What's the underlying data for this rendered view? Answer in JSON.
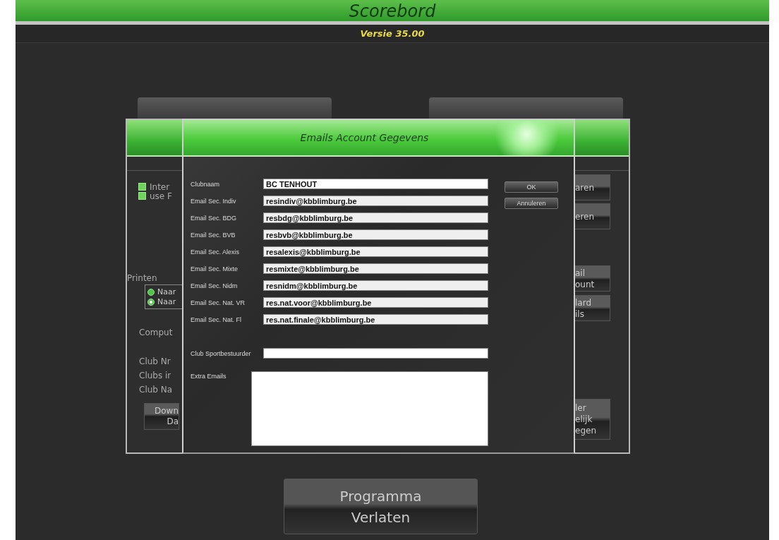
{
  "app": {
    "title": "Scorebord",
    "version": "Versie 35.00"
  },
  "background_window": {
    "checkboxes": [
      {
        "label": "Inter",
        "checked": true
      },
      {
        "label": "use F",
        "checked": true
      }
    ],
    "print_group": {
      "label": "Printen",
      "options": [
        {
          "label": "Naar",
          "selected": false
        },
        {
          "label": "Naar",
          "selected": true
        }
      ]
    },
    "labels": [
      "Comput",
      "Club Nr",
      "Clubs ir",
      "Club Na"
    ],
    "left_button": {
      "lines": [
        "Down",
        "Da"
      ]
    },
    "right_buttons": [
      {
        "lines": [
          "aren"
        ]
      },
      {
        "lines": [
          "eren"
        ]
      },
      {
        "lines": [
          "ail",
          "ount"
        ]
      },
      {
        "lines": [
          "lard",
          "ils"
        ]
      },
      {
        "lines": [
          "ler",
          "elijk",
          "egen"
        ]
      }
    ]
  },
  "dialog": {
    "title": "Emails Account Gegevens",
    "fields": [
      {
        "label": "Clubnaam",
        "value": "BC TENHOUT",
        "readonly": false
      },
      {
        "label": "Email Sec. Indiv",
        "value": "resindiv@kbblimburg.be",
        "readonly": true
      },
      {
        "label": "Email Sec. BDG",
        "value": "resbdg@kbblimburg.be",
        "readonly": true
      },
      {
        "label": "Email Sec. BVB",
        "value": "resbvb@kbblimburg.be",
        "readonly": true
      },
      {
        "label": "Email Sec. Alexis",
        "value": "resalexis@kbblimburg.be",
        "readonly": true
      },
      {
        "label": "Email Sec. Mixte",
        "value": "resmixte@kbblimburg.be",
        "readonly": true
      },
      {
        "label": "Email Sec. Nidm",
        "value": "resnidm@kbblimburg.be",
        "readonly": true
      },
      {
        "label": "Email Sec. Nat. VR",
        "value": "res.nat.voor@kbblimburg.be",
        "readonly": true
      },
      {
        "label": "Email Sec. Nat. Fl",
        "value": "res.nat.finale@kbblimburg.be",
        "readonly": true
      }
    ],
    "sportbestuurder": {
      "label": "Club Sportbestuurder",
      "readonly": false
    },
    "extra_emails": {
      "label": "Extra Emails"
    },
    "buttons": [
      "OK",
      "Annuleren"
    ]
  },
  "exit_button": "Programma Verlaten"
}
